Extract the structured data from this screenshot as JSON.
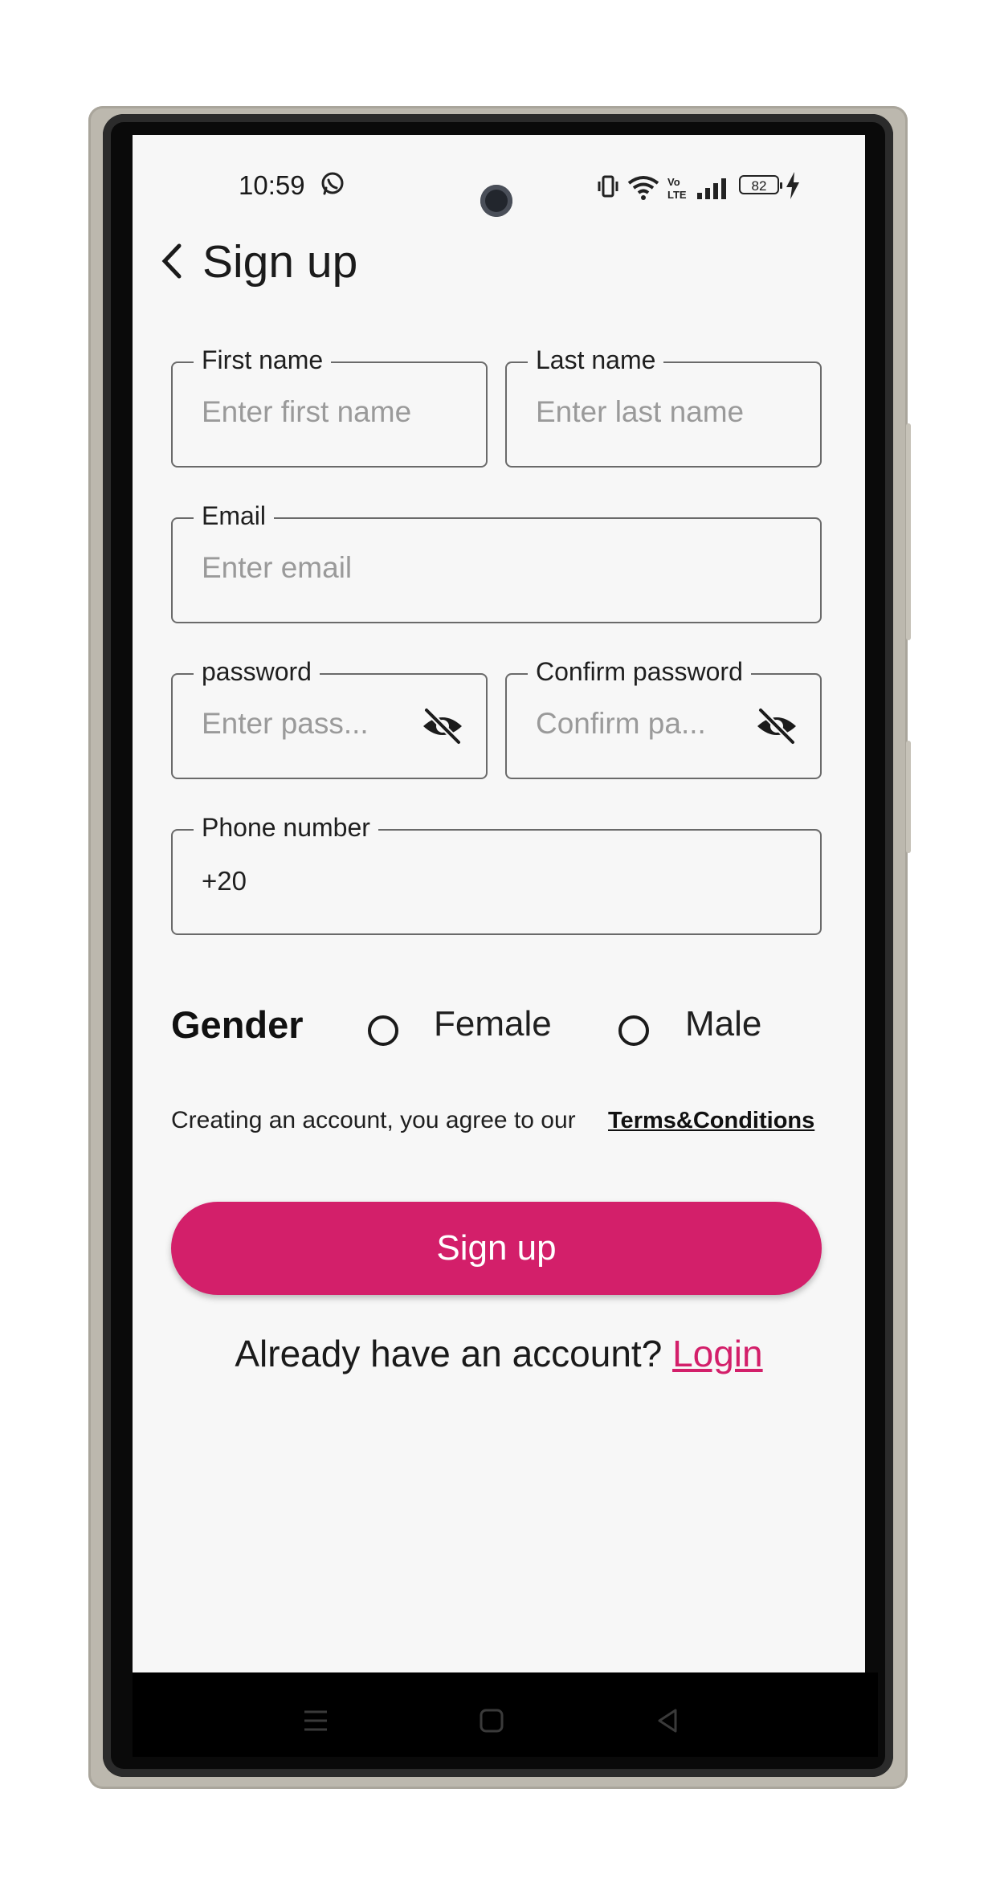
{
  "status_bar": {
    "time": "10:59",
    "battery": "82",
    "icons": [
      "whatsapp-icon",
      "vibrate-icon",
      "wifi-icon",
      "volte-icon",
      "signal-icon",
      "battery-icon",
      "charging-icon"
    ]
  },
  "header": {
    "title": "Sign up",
    "back_icon": "chevron-left-icon"
  },
  "form": {
    "first_name": {
      "label": "First name",
      "placeholder": "Enter first name"
    },
    "last_name": {
      "label": "Last name",
      "placeholder": "Enter last name"
    },
    "email": {
      "label": "Email",
      "placeholder": "Enter email"
    },
    "password": {
      "label": "password",
      "placeholder": "Enter pass...",
      "toggle_icon": "eye-off-icon"
    },
    "confirm_password": {
      "label": "Confirm password",
      "placeholder": "Confirm pa...",
      "toggle_icon": "eye-off-icon"
    },
    "phone": {
      "label": "Phone number",
      "value": "+20"
    }
  },
  "gender": {
    "label": "Gender",
    "options": [
      "Female",
      "Male"
    ]
  },
  "terms": {
    "text": "Creating an account, you agree to our",
    "link": "Terms&Conditions"
  },
  "actions": {
    "signup_label": "Sign up",
    "account_prompt": "Already have an account?",
    "login_label": "Login"
  },
  "colors": {
    "accent": "#d31f6a",
    "background": "#f7f7f7"
  }
}
